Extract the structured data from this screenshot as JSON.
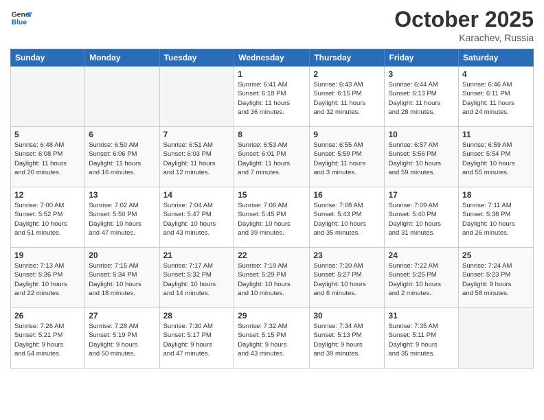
{
  "header": {
    "logo_line1": "General",
    "logo_line2": "Blue",
    "month": "October 2025",
    "location": "Karachev, Russia"
  },
  "weekdays": [
    "Sunday",
    "Monday",
    "Tuesday",
    "Wednesday",
    "Thursday",
    "Friday",
    "Saturday"
  ],
  "weeks": [
    [
      {
        "day": "",
        "info": ""
      },
      {
        "day": "",
        "info": ""
      },
      {
        "day": "",
        "info": ""
      },
      {
        "day": "1",
        "info": "Sunrise: 6:41 AM\nSunset: 6:18 PM\nDaylight: 11 hours\nand 36 minutes."
      },
      {
        "day": "2",
        "info": "Sunrise: 6:43 AM\nSunset: 6:15 PM\nDaylight: 11 hours\nand 32 minutes."
      },
      {
        "day": "3",
        "info": "Sunrise: 6:44 AM\nSunset: 6:13 PM\nDaylight: 11 hours\nand 28 minutes."
      },
      {
        "day": "4",
        "info": "Sunrise: 6:46 AM\nSunset: 6:11 PM\nDaylight: 11 hours\nand 24 minutes."
      }
    ],
    [
      {
        "day": "5",
        "info": "Sunrise: 6:48 AM\nSunset: 6:08 PM\nDaylight: 11 hours\nand 20 minutes."
      },
      {
        "day": "6",
        "info": "Sunrise: 6:50 AM\nSunset: 6:06 PM\nDaylight: 11 hours\nand 16 minutes."
      },
      {
        "day": "7",
        "info": "Sunrise: 6:51 AM\nSunset: 6:03 PM\nDaylight: 11 hours\nand 12 minutes."
      },
      {
        "day": "8",
        "info": "Sunrise: 6:53 AM\nSunset: 6:01 PM\nDaylight: 11 hours\nand 7 minutes."
      },
      {
        "day": "9",
        "info": "Sunrise: 6:55 AM\nSunset: 5:59 PM\nDaylight: 11 hours\nand 3 minutes."
      },
      {
        "day": "10",
        "info": "Sunrise: 6:57 AM\nSunset: 5:56 PM\nDaylight: 10 hours\nand 59 minutes."
      },
      {
        "day": "11",
        "info": "Sunrise: 6:59 AM\nSunset: 5:54 PM\nDaylight: 10 hours\nand 55 minutes."
      }
    ],
    [
      {
        "day": "12",
        "info": "Sunrise: 7:00 AM\nSunset: 5:52 PM\nDaylight: 10 hours\nand 51 minutes."
      },
      {
        "day": "13",
        "info": "Sunrise: 7:02 AM\nSunset: 5:50 PM\nDaylight: 10 hours\nand 47 minutes."
      },
      {
        "day": "14",
        "info": "Sunrise: 7:04 AM\nSunset: 5:47 PM\nDaylight: 10 hours\nand 43 minutes."
      },
      {
        "day": "15",
        "info": "Sunrise: 7:06 AM\nSunset: 5:45 PM\nDaylight: 10 hours\nand 39 minutes."
      },
      {
        "day": "16",
        "info": "Sunrise: 7:08 AM\nSunset: 5:43 PM\nDaylight: 10 hours\nand 35 minutes."
      },
      {
        "day": "17",
        "info": "Sunrise: 7:09 AM\nSunset: 5:40 PM\nDaylight: 10 hours\nand 31 minutes."
      },
      {
        "day": "18",
        "info": "Sunrise: 7:11 AM\nSunset: 5:38 PM\nDaylight: 10 hours\nand 26 minutes."
      }
    ],
    [
      {
        "day": "19",
        "info": "Sunrise: 7:13 AM\nSunset: 5:36 PM\nDaylight: 10 hours\nand 22 minutes."
      },
      {
        "day": "20",
        "info": "Sunrise: 7:15 AM\nSunset: 5:34 PM\nDaylight: 10 hours\nand 18 minutes."
      },
      {
        "day": "21",
        "info": "Sunrise: 7:17 AM\nSunset: 5:32 PM\nDaylight: 10 hours\nand 14 minutes."
      },
      {
        "day": "22",
        "info": "Sunrise: 7:19 AM\nSunset: 5:29 PM\nDaylight: 10 hours\nand 10 minutes."
      },
      {
        "day": "23",
        "info": "Sunrise: 7:20 AM\nSunset: 5:27 PM\nDaylight: 10 hours\nand 6 minutes."
      },
      {
        "day": "24",
        "info": "Sunrise: 7:22 AM\nSunset: 5:25 PM\nDaylight: 10 hours\nand 2 minutes."
      },
      {
        "day": "25",
        "info": "Sunrise: 7:24 AM\nSunset: 5:23 PM\nDaylight: 9 hours\nand 58 minutes."
      }
    ],
    [
      {
        "day": "26",
        "info": "Sunrise: 7:26 AM\nSunset: 5:21 PM\nDaylight: 9 hours\nand 54 minutes."
      },
      {
        "day": "27",
        "info": "Sunrise: 7:28 AM\nSunset: 5:19 PM\nDaylight: 9 hours\nand 50 minutes."
      },
      {
        "day": "28",
        "info": "Sunrise: 7:30 AM\nSunset: 5:17 PM\nDaylight: 9 hours\nand 47 minutes."
      },
      {
        "day": "29",
        "info": "Sunrise: 7:32 AM\nSunset: 5:15 PM\nDaylight: 9 hours\nand 43 minutes."
      },
      {
        "day": "30",
        "info": "Sunrise: 7:34 AM\nSunset: 5:13 PM\nDaylight: 9 hours\nand 39 minutes."
      },
      {
        "day": "31",
        "info": "Sunrise: 7:35 AM\nSunset: 5:11 PM\nDaylight: 9 hours\nand 35 minutes."
      },
      {
        "day": "",
        "info": ""
      }
    ]
  ]
}
